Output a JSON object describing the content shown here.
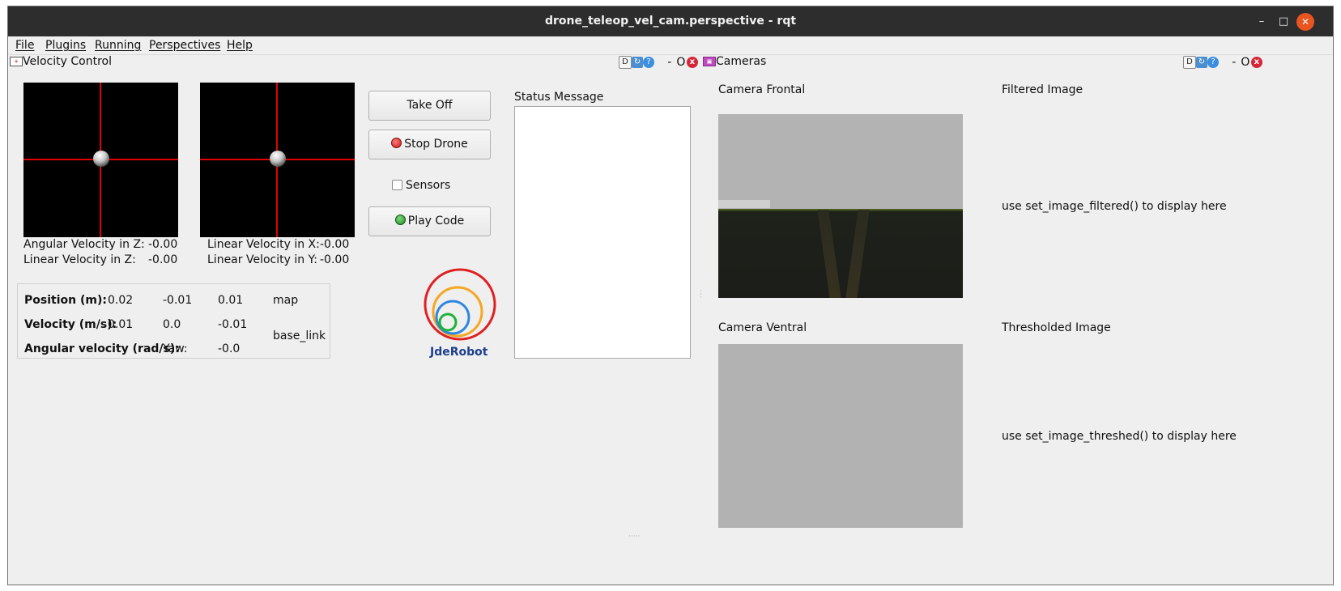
{
  "window": {
    "title": "drone_teleop_vel_cam.perspective - rqt",
    "minimize": "–",
    "maximize": "□",
    "close": "✕"
  },
  "menu": [
    "File",
    "Plugins",
    "Running",
    "Perspectives",
    "Help"
  ],
  "velocity_dock": {
    "title": "Velocity Control",
    "tools": [
      "D",
      "↻",
      "?",
      "-",
      "O",
      "x"
    ],
    "joystick_left": {
      "angular_z_label": "Angular Velocity in Z:",
      "angular_z_value": "-0.00",
      "linear_z_label": "Linear Velocity in Z:",
      "linear_z_value": "-0.00"
    },
    "joystick_right": {
      "linear_x_label": "Linear Velocity in X:",
      "linear_x_value": "-0.00",
      "linear_y_label": "Linear Velocity in Y:",
      "linear_y_value": "-0.00"
    },
    "buttons": {
      "take_off": "Take Off",
      "stop_drone": "Stop Drone",
      "sensors": "Sensors",
      "play_code": "Play Code"
    },
    "logo_text": "JdeRobot",
    "status_label": "Status Message",
    "status_text": "",
    "info": {
      "position_label": "Position (m):",
      "position": [
        "0.02",
        "-0.01",
        "0.01"
      ],
      "position_frame": "map",
      "velocity_label": "Velocity (m/s):",
      "velocity": [
        "0.01",
        "0.0",
        "-0.01"
      ],
      "velocity_frame": "base_link",
      "angular_label": "Angular velocity (rad/s):",
      "yaw_label": "Yaw:",
      "yaw_value": "-0.0"
    }
  },
  "cameras_dock": {
    "title": "Cameras",
    "tools": [
      "D",
      "↻",
      "?",
      "-",
      "O",
      "x"
    ],
    "frontal_label": "Camera Frontal",
    "ventral_label": "Camera Ventral",
    "filtered_label": "Filtered Image",
    "filtered_hint": "use set_image_filtered() to display here",
    "thresholded_label": "Thresholded Image",
    "thresholded_hint": "use set_image_threshed() to display here"
  }
}
